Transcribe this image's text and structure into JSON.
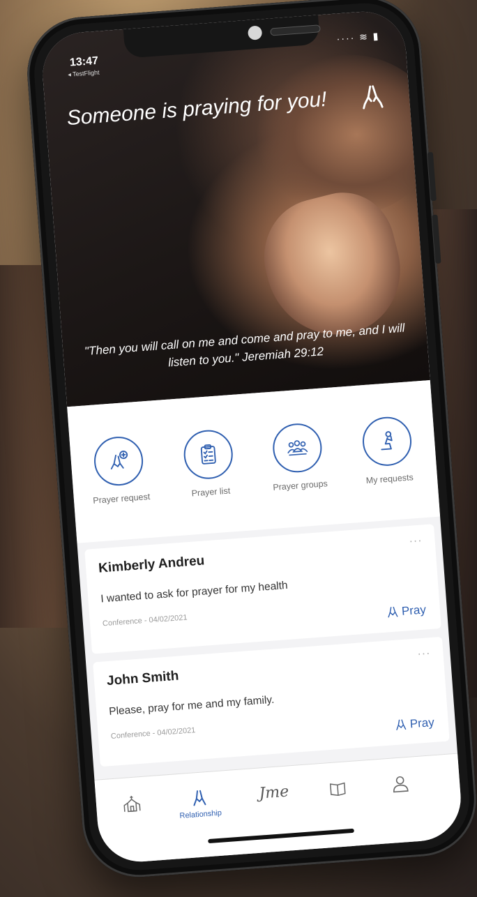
{
  "status": {
    "time": "13:47",
    "back_label": "◂ TestFlight"
  },
  "hero": {
    "title": "Someone is praying for you!",
    "quote": "\"Then you will call on me and come and pray to me, and I will listen to you.\" Jeremiah 29:12"
  },
  "shortcuts": [
    {
      "label": "Prayer request",
      "icon": "praying-hands-plus-icon"
    },
    {
      "label": "Prayer list",
      "icon": "clipboard-list-icon"
    },
    {
      "label": "Prayer groups",
      "icon": "group-icon"
    },
    {
      "label": "My requests",
      "icon": "kneeling-person-icon"
    }
  ],
  "requests": [
    {
      "name": "Kimberly Andreu",
      "text": "I wanted to ask for prayer for my health",
      "meta": "Conference - 04/02/2021",
      "action": "Pray"
    },
    {
      "name": "John Smith",
      "text": "Please, pray for me and my family.",
      "meta": "Conference - 04/02/2021",
      "action": "Pray"
    }
  ],
  "tabbar": {
    "active_label": "Relationship",
    "script_label": "Jme",
    "icons": [
      "church-icon",
      "praying-hands-icon",
      "jme-logo",
      "book-icon",
      "person-icon"
    ]
  },
  "colors": {
    "accent": "#2f5fb0"
  }
}
